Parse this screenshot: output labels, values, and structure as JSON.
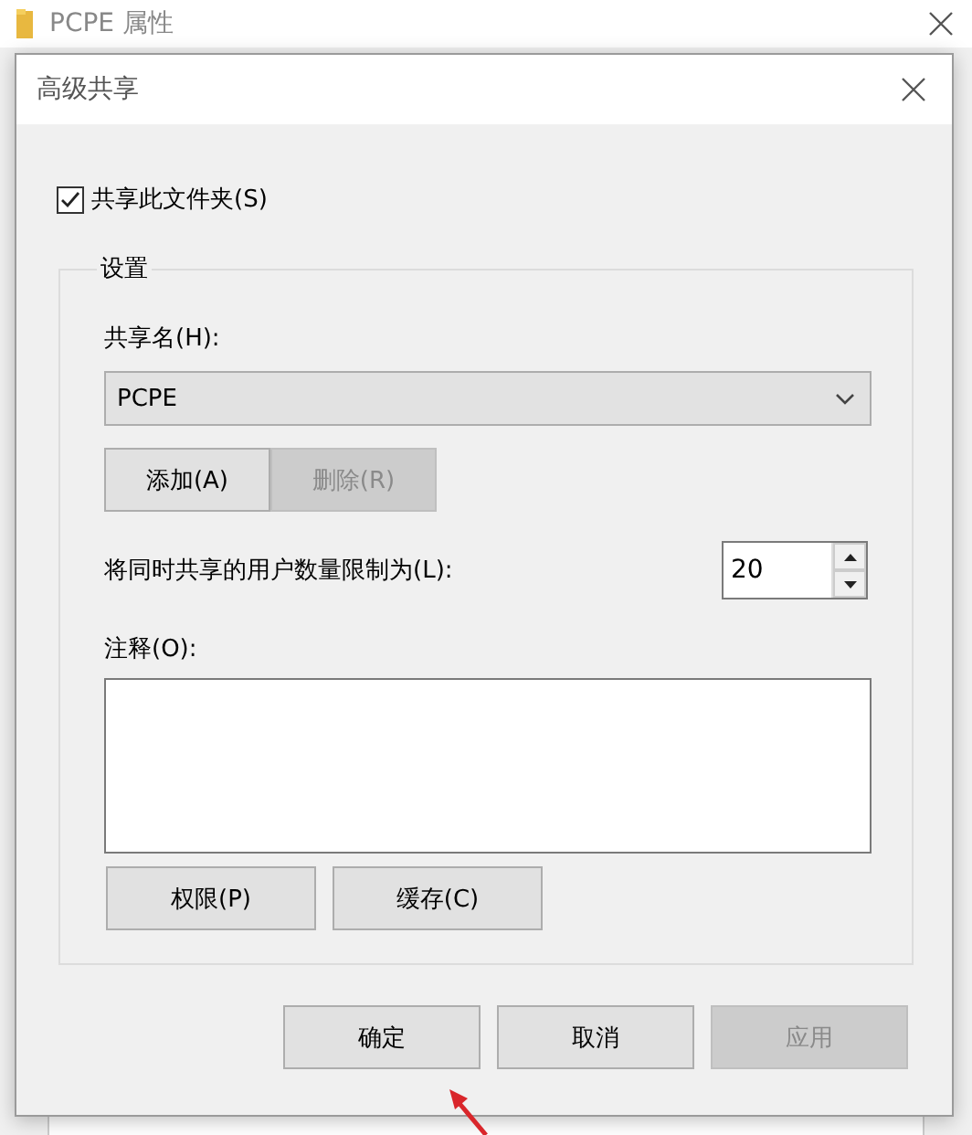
{
  "background_window": {
    "title": "PCPE 属性"
  },
  "dialog": {
    "title": "高级共享",
    "share_checkbox": {
      "label": "共享此文件夹(S)",
      "checked": true
    },
    "settings": {
      "title": "设置",
      "share_name_label": "共享名(H):",
      "share_name": {
        "value": "PCPE"
      },
      "name_buttons": [
        {
          "label": "添加(A)",
          "disabled": false
        },
        {
          "label": "删除(R)",
          "disabled": true
        }
      ],
      "limit_label": "将同时共享的用户数量限制为(L):",
      "limit_value": "20",
      "comment_label": "注释(O):",
      "buttons": [
        {
          "label": "权限(P)",
          "disabled": false
        },
        {
          "label": "缓存(C)",
          "disabled": false
        }
      ]
    },
    "footer_buttons": [
      {
        "label": "确定",
        "disabled": false
      },
      {
        "label": "取消",
        "disabled": false
      },
      {
        "label": "应用",
        "disabled": true
      }
    ]
  }
}
